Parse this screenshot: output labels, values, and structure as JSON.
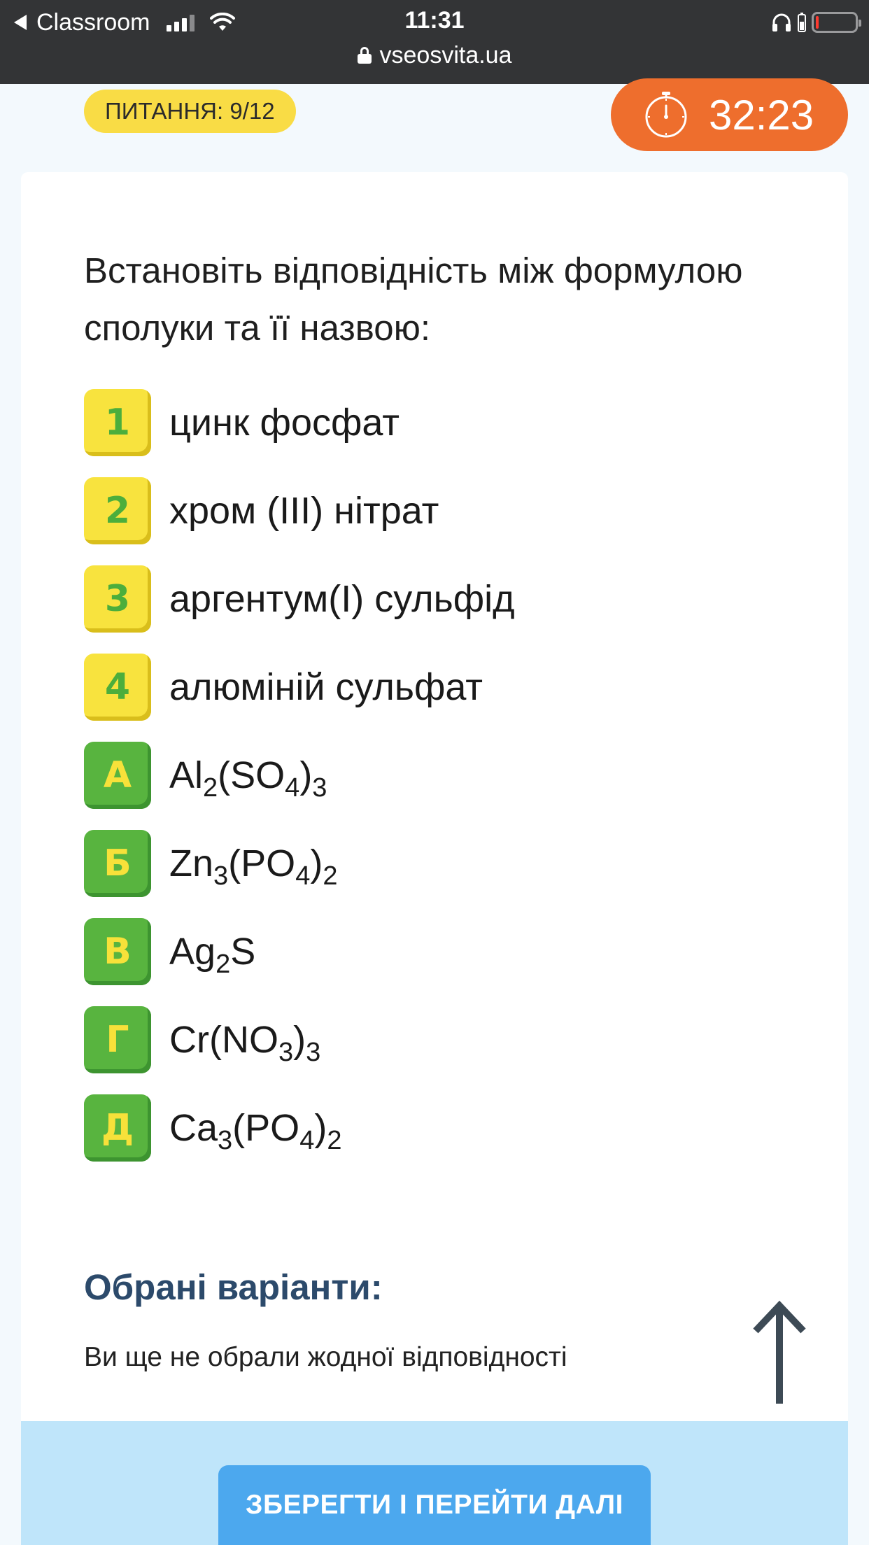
{
  "status_bar": {
    "back_app": "Classroom",
    "time": "11:31",
    "url": "vseosvita.ua"
  },
  "header": {
    "question_counter": "ПИТАННЯ: 9/12",
    "timer": "32:23"
  },
  "question": {
    "text": "Встановіть відповідність між формулою сполуки та її назвою:"
  },
  "numbered_options": [
    {
      "key": "1",
      "text": "цинк фосфат"
    },
    {
      "key": "2",
      "text": "хром (ІІІ) нітрат"
    },
    {
      "key": "3",
      "text": "аргентум(І) сульфід"
    },
    {
      "key": "4",
      "text": "алюміній сульфат"
    }
  ],
  "lettered_options": [
    {
      "key": "А",
      "parts": [
        "Al",
        "2",
        "(SO",
        "4",
        ")",
        "3"
      ]
    },
    {
      "key": "Б",
      "parts": [
        "Zn",
        "3",
        "(PO",
        "4",
        ")",
        "2"
      ]
    },
    {
      "key": "В",
      "parts": [
        "Ag",
        "2",
        "S"
      ]
    },
    {
      "key": "Г",
      "parts": [
        "Cr(NO",
        "3",
        ")",
        "3"
      ]
    },
    {
      "key": "Д",
      "parts": [
        "Ca",
        "3",
        "(PO",
        "4",
        ")",
        "2"
      ]
    }
  ],
  "chosen": {
    "title": "Обрані варіанти:",
    "empty_text": "Ви ще не обрали жодної відповідності"
  },
  "footer": {
    "save_label": "ЗБЕРЕГТИ І ПЕРЕЙТИ ДАЛІ"
  },
  "colors": {
    "status_bar": "#333436",
    "badge_yellow": "#f9dc45",
    "timer_orange": "#ee6e2d",
    "option_yellow": "#f8e33e",
    "option_green": "#58b43f",
    "heading_blue": "#2c4a6b",
    "footer_blue": "#bfe5fa",
    "button_blue": "#4ca8ee"
  },
  "icons": [
    "back-arrow-icon",
    "signal-icon",
    "wifi-icon",
    "headphones-icon",
    "battery-icon",
    "lock-icon",
    "stopwatch-icon",
    "up-arrow-icon"
  ]
}
